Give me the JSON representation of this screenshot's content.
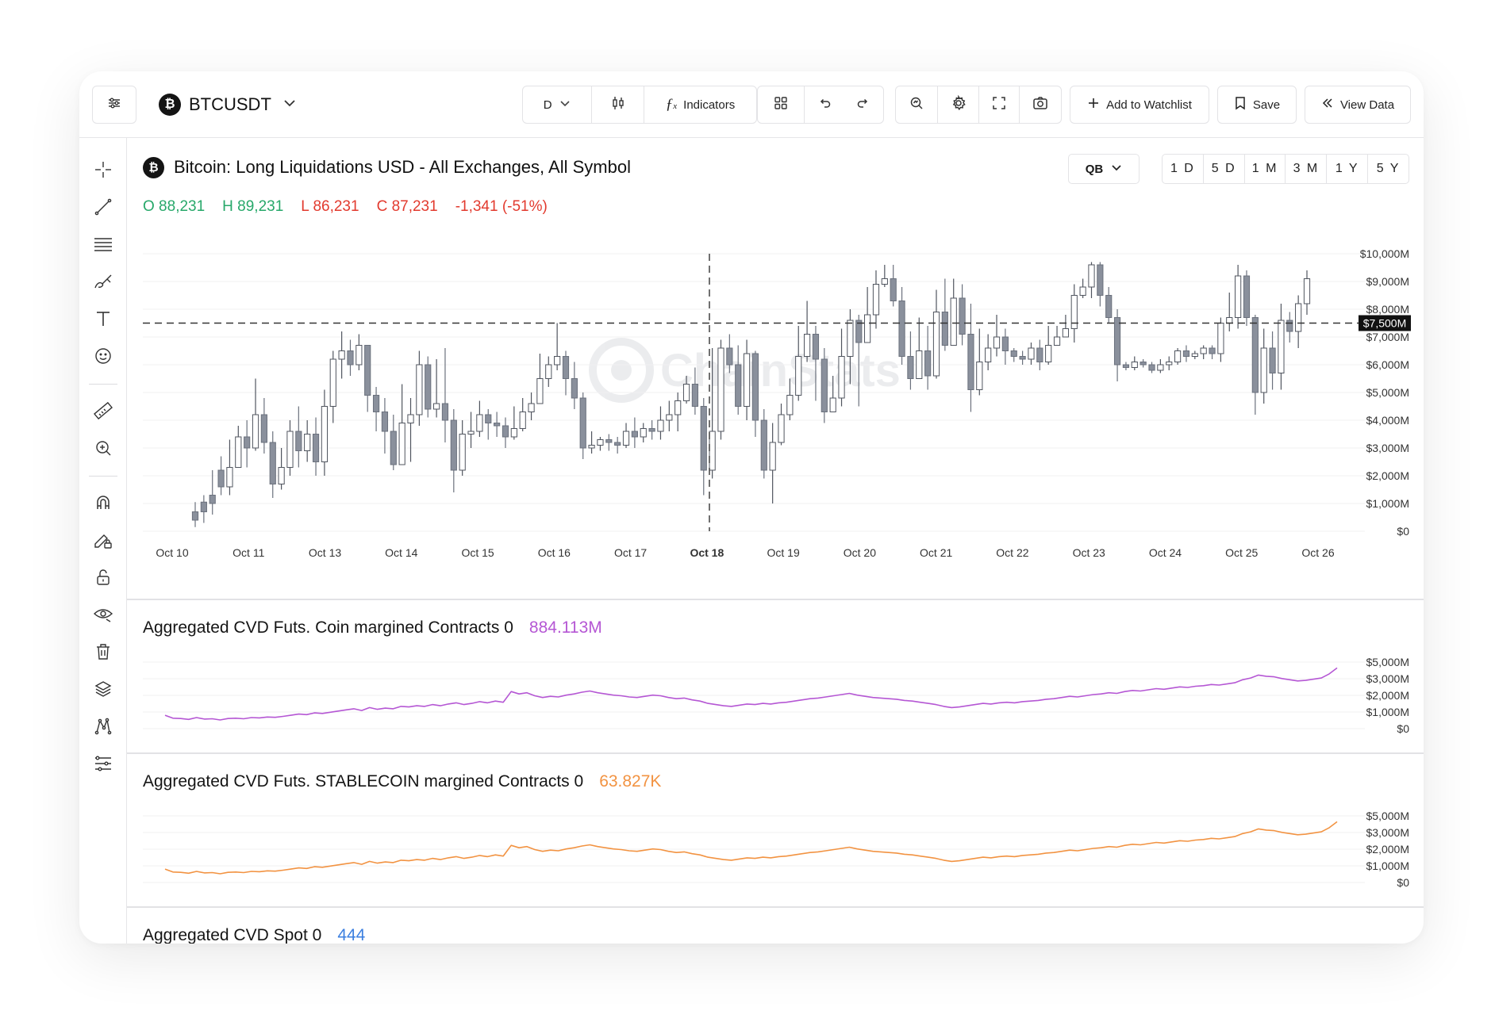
{
  "toolbar": {
    "symbol": "BTCUSDT",
    "interval": "D",
    "indicators_label": "Indicators",
    "add_watchlist_label": "Add to Watchlist",
    "save_label": "Save",
    "view_data_label": "View Data"
  },
  "chart": {
    "title": "Bitcoin: Long Liquidations USD - All Exchanges, All Symbol",
    "ohlc": {
      "open": "O 88,231",
      "high": "H 89,231",
      "low": "L 86,231",
      "close": "C 87,231",
      "change": "-1,341 (-51%)"
    },
    "source_selector": "QB",
    "ranges": [
      "1 D",
      "5 D",
      "1 M",
      "3 M",
      "1 Y",
      "5 Y"
    ],
    "watermark": "ChainStats",
    "price_label": "$7,500M",
    "crosshair_date": "Oct 18"
  },
  "colors": {
    "up": "#27a86a",
    "down": "#e23a2e",
    "coin_cvd": "#b557d4",
    "stable_cvd": "#f29342",
    "spot_cvd": "#3b7fe0",
    "candle_bear": "#8a909c"
  },
  "chart_data": [
    {
      "type": "candlestick",
      "title": "Bitcoin: Long Liquidations USD - All Exchanges, All Symbol",
      "x_tick_labels": [
        "Oct 10",
        "Oct 11",
        "Oct 13",
        "Oct 14",
        "Oct 15",
        "Oct 16",
        "Oct 17",
        "Oct 18",
        "Oct 19",
        "Oct 20",
        "Oct 21",
        "Oct 22",
        "Oct 23",
        "Oct 24",
        "Oct 25",
        "Oct 26"
      ],
      "y_tick_labels": [
        "$10,000M",
        "$9,000M",
        "$8,000M",
        "$7,000M",
        "$6,000M",
        "$5,000M",
        "$4,000M",
        "$3,000M",
        "$2,000M",
        "$1,000M",
        "$0"
      ],
      "ylim": [
        0,
        10000
      ],
      "y_unit": "$M",
      "horizontal_line": 7500,
      "candles": [
        [
          700,
          400,
          1050,
          150
        ],
        [
          1050,
          700,
          1300,
          300
        ],
        [
          1300,
          1000,
          2200,
          600
        ],
        [
          2200,
          1600,
          2700,
          1300
        ],
        [
          1600,
          2300,
          3300,
          1300
        ],
        [
          2300,
          3400,
          3800,
          2500
        ],
        [
          3400,
          3000,
          4000,
          2300
        ],
        [
          3000,
          4200,
          5500,
          2900
        ],
        [
          4200,
          3200,
          4800,
          2800
        ],
        [
          3200,
          1700,
          3600,
          1200
        ],
        [
          1700,
          2300,
          3000,
          1500
        ],
        [
          2300,
          3600,
          4000,
          2000
        ],
        [
          3600,
          2900,
          4500,
          2300
        ],
        [
          2900,
          3500,
          4000,
          2500
        ],
        [
          3500,
          2500,
          4100,
          2000
        ],
        [
          2500,
          4500,
          5100,
          2000
        ],
        [
          4500,
          6200,
          6500,
          3900
        ],
        [
          6200,
          6500,
          7200,
          5500
        ],
        [
          6500,
          6000,
          6900,
          5600
        ],
        [
          6000,
          6700,
          7100,
          5800
        ],
        [
          6700,
          4900,
          6200,
          4300
        ],
        [
          4900,
          4300,
          5200,
          3600
        ],
        [
          4300,
          3600,
          4800,
          2800
        ],
        [
          3600,
          2400,
          4200,
          2200
        ],
        [
          2400,
          3900,
          5300,
          3200
        ],
        [
          3900,
          4200,
          4800,
          2500
        ],
        [
          4200,
          6000,
          6500,
          3800
        ],
        [
          6000,
          4400,
          6300,
          4100
        ],
        [
          4400,
          4600,
          6200,
          4100
        ],
        [
          4600,
          4000,
          6600,
          3200
        ],
        [
          4000,
          2200,
          4400,
          1400
        ],
        [
          2200,
          3500,
          4000,
          2000
        ],
        [
          3500,
          3600,
          4300,
          3000
        ],
        [
          3600,
          4200,
          4700,
          3400
        ],
        [
          4200,
          3900,
          4400,
          3300
        ],
        [
          3900,
          3800,
          4300,
          3400
        ],
        [
          3800,
          3400,
          4100,
          3000
        ],
        [
          3400,
          3700,
          4500,
          3300
        ],
        [
          3700,
          4300,
          4800,
          3600
        ],
        [
          4300,
          4600,
          5000,
          4000
        ],
        [
          4600,
          5500,
          6400,
          5000
        ],
        [
          5500,
          6000,
          6300,
          5200
        ],
        [
          6000,
          6300,
          7500,
          5800
        ],
        [
          6300,
          5500,
          6500,
          4900
        ],
        [
          5500,
          4800,
          6100,
          4400
        ],
        [
          4800,
          3000,
          5000,
          2600
        ],
        [
          3000,
          3100,
          3600,
          2800
        ],
        [
          3100,
          3300,
          3400,
          2900
        ],
        [
          3300,
          3200,
          3500,
          2900
        ],
        [
          3200,
          3100,
          3400,
          2800
        ],
        [
          3100,
          3600,
          3900,
          3000
        ],
        [
          3600,
          3400,
          4100,
          3000
        ],
        [
          3400,
          3700,
          3900,
          3200
        ],
        [
          3700,
          3600,
          4000,
          3300
        ],
        [
          3600,
          4000,
          4500,
          3300
        ],
        [
          4000,
          4200,
          4700,
          3600
        ],
        [
          4200,
          4700,
          5000,
          3600
        ],
        [
          4700,
          5300,
          5600,
          4600
        ],
        [
          5300,
          4500,
          5900,
          4200
        ],
        [
          4500,
          2200,
          4800,
          1300
        ],
        [
          2200,
          3600,
          6600,
          1900
        ],
        [
          3600,
          6600,
          6900,
          3300
        ],
        [
          6600,
          6000,
          7100,
          5700
        ],
        [
          6000,
          4500,
          6700,
          4200
        ],
        [
          4500,
          6400,
          6900,
          4000
        ],
        [
          6400,
          4000,
          6500,
          3400
        ],
        [
          4000,
          2200,
          4400,
          1900
        ],
        [
          2200,
          3200,
          3900,
          1000
        ],
        [
          3200,
          4200,
          4600,
          3100
        ],
        [
          4200,
          4900,
          5500,
          4000
        ],
        [
          4900,
          6300,
          7400,
          4700
        ],
        [
          6300,
          7100,
          8300,
          6100
        ],
        [
          7100,
          6200,
          7400,
          4700
        ],
        [
          6200,
          4300,
          6600,
          3900
        ],
        [
          4300,
          4800,
          5600,
          4300
        ],
        [
          4800,
          6300,
          7300,
          4500
        ],
        [
          6300,
          7600,
          8000,
          5300
        ],
        [
          7600,
          6800,
          7800,
          4500
        ],
        [
          6800,
          7800,
          8800,
          6800
        ],
        [
          7800,
          8900,
          9400,
          7300
        ],
        [
          8900,
          9100,
          9600,
          8800
        ],
        [
          9100,
          8300,
          9600,
          8100
        ],
        [
          8300,
          6300,
          8800,
          6000
        ],
        [
          6300,
          5500,
          7200,
          5100
        ],
        [
          5500,
          6500,
          7700,
          6000
        ],
        [
          6500,
          5600,
          7400,
          5100
        ],
        [
          5600,
          7900,
          8700,
          5500
        ],
        [
          7900,
          6700,
          9100,
          6500
        ],
        [
          6700,
          8400,
          9100,
          7300
        ],
        [
          8400,
          7100,
          8900,
          6700
        ],
        [
          7100,
          5100,
          8200,
          4300
        ],
        [
          5100,
          6100,
          7300,
          4900
        ],
        [
          6100,
          6600,
          7100,
          5800
        ],
        [
          6600,
          7000,
          7800,
          6300
        ],
        [
          7000,
          6500,
          7300,
          6000
        ],
        [
          6500,
          6300,
          6600,
          6100
        ],
        [
          6300,
          6200,
          6500,
          6000
        ],
        [
          6200,
          6600,
          6800,
          6000
        ],
        [
          6600,
          6100,
          6900,
          5800
        ],
        [
          6100,
          6700,
          7400,
          6000
        ],
        [
          6700,
          7000,
          7400,
          6700
        ],
        [
          7000,
          7300,
          7800,
          7000
        ],
        [
          7300,
          8500,
          8900,
          6800
        ],
        [
          8500,
          8800,
          9100,
          8400
        ],
        [
          8800,
          9600,
          9700,
          8400
        ],
        [
          9600,
          8500,
          9700,
          8100
        ],
        [
          8500,
          7700,
          8800,
          7500
        ],
        [
          7700,
          6000,
          8000,
          5400
        ],
        [
          6000,
          5900,
          6100,
          5800
        ],
        [
          5900,
          6100,
          6300,
          5800
        ],
        [
          6100,
          6000,
          6200,
          5900
        ],
        [
          6000,
          5800,
          6100,
          5700
        ],
        [
          5800,
          6000,
          6200,
          5700
        ],
        [
          6000,
          6100,
          6300,
          5800
        ],
        [
          6100,
          6500,
          6600,
          6000
        ],
        [
          6500,
          6300,
          6700,
          6100
        ],
        [
          6300,
          6400,
          6500,
          6200
        ],
        [
          6400,
          6600,
          6700,
          6200
        ],
        [
          6600,
          6400,
          6700,
          6200
        ],
        [
          6400,
          7500,
          7700,
          6100
        ],
        [
          7500,
          7700,
          8600,
          7200
        ],
        [
          7700,
          9200,
          9600,
          7300
        ],
        [
          9200,
          7700,
          9400,
          7400
        ],
        [
          7700,
          5000,
          7800,
          4200
        ],
        [
          5000,
          6600,
          7300,
          4600
        ],
        [
          6600,
          5700,
          7200,
          5100
        ],
        [
          5700,
          7600,
          8200,
          5100
        ],
        [
          7600,
          7200,
          7900,
          6800
        ],
        [
          7200,
          8200,
          8500,
          6600
        ],
        [
          8200,
          9100,
          9400,
          7800
        ]
      ]
    },
    {
      "type": "line",
      "title": "Aggregated CVD Futs. Coin margined Contracts 0",
      "value_label": "884.113M",
      "y_tick_labels": [
        "$5,000M",
        "$3,000M",
        "$2,000M",
        "$1,000M",
        "$0"
      ],
      "values": [
        1200,
        700,
        650,
        500,
        800,
        550,
        600,
        400,
        650,
        700,
        600,
        800,
        750,
        900,
        850,
        1000,
        1200,
        1400,
        1300,
        1600,
        1500,
        1700,
        1900,
        2100,
        2300,
        2000,
        2500,
        2200,
        2400,
        2300,
        2700,
        2600,
        2800,
        2700,
        3000,
        2800,
        3100,
        3300,
        3000,
        3200,
        3500,
        3300,
        3600,
        3400,
        5200,
        4800,
        5000,
        4500,
        4200,
        4400,
        4300,
        4600,
        4800,
        5100,
        5300,
        5000,
        4800,
        4600,
        4500,
        4300,
        4200,
        4400,
        4600,
        4500,
        4200,
        4000,
        4100,
        3800,
        3600,
        3200,
        3000,
        2800,
        2700,
        2900,
        3100,
        3000,
        3200,
        3100,
        3300,
        3400,
        3600,
        3800,
        4000,
        4100,
        4300,
        4500,
        4700,
        4900,
        4600,
        4400,
        4200,
        4100,
        4000,
        3900,
        3700,
        3600,
        3400,
        3200,
        3000,
        2700,
        2500,
        2600,
        2800,
        3000,
        3200,
        3100,
        3300,
        3400,
        3300,
        3500,
        3600,
        3700,
        3900,
        4000,
        4200,
        4400,
        4300,
        4500,
        4700,
        4800,
        5000,
        4900,
        5200,
        5400,
        5300,
        5500,
        5700,
        5600,
        5800,
        6000,
        5900,
        6100,
        6200,
        6400,
        6300,
        6500,
        6700,
        7200,
        7500,
        8000,
        7800,
        7700,
        7400,
        7200,
        7000,
        7100,
        7300,
        7500,
        8200,
        9200
      ]
    },
    {
      "type": "line",
      "title": "Aggregated CVD Futs. STABLECOIN margined Contracts 0",
      "value_label": "63.827K",
      "y_tick_labels": [
        "$5,000M",
        "$3,000M",
        "$2,000M",
        "$1,000M",
        "$0"
      ],
      "values": [
        1200,
        700,
        650,
        500,
        800,
        550,
        600,
        400,
        650,
        700,
        600,
        800,
        750,
        900,
        850,
        1000,
        1200,
        1400,
        1300,
        1600,
        1500,
        1700,
        1900,
        2100,
        2300,
        2000,
        2500,
        2200,
        2400,
        2300,
        2700,
        2600,
        2800,
        2700,
        3000,
        2800,
        3100,
        3300,
        3000,
        3200,
        3500,
        3300,
        3600,
        3400,
        5200,
        4800,
        5000,
        4500,
        4200,
        4400,
        4300,
        4600,
        4800,
        5100,
        5300,
        5000,
        4800,
        4600,
        4500,
        4300,
        4200,
        4400,
        4600,
        4500,
        4200,
        4000,
        4100,
        3800,
        3600,
        3200,
        3000,
        2800,
        2700,
        2900,
        3100,
        3000,
        3200,
        3100,
        3300,
        3400,
        3600,
        3800,
        4000,
        4100,
        4300,
        4500,
        4700,
        4900,
        4600,
        4400,
        4200,
        4100,
        4000,
        3900,
        3700,
        3600,
        3400,
        3200,
        3000,
        2700,
        2500,
        2600,
        2800,
        3000,
        3200,
        3100,
        3300,
        3400,
        3300,
        3500,
        3600,
        3700,
        3900,
        4000,
        4200,
        4400,
        4300,
        4500,
        4700,
        4800,
        5000,
        4900,
        5200,
        5400,
        5300,
        5500,
        5700,
        5600,
        5800,
        6000,
        5900,
        6100,
        6200,
        6400,
        6300,
        6500,
        6700,
        7200,
        7500,
        8000,
        7800,
        7700,
        7400,
        7200,
        7000,
        7100,
        7300,
        7500,
        8200,
        9200
      ]
    }
  ],
  "panes": {
    "coin": {
      "title": "Aggregated CVD Futs. Coin margined Contracts 0",
      "value": "884.113M"
    },
    "stable": {
      "title": "Aggregated CVD Futs. STABLECOIN margined Contracts 0",
      "value": "63.827K"
    },
    "spot": {
      "title": "Aggregated CVD Spot 0",
      "value": "444"
    }
  },
  "icons": [
    "sliders-icon",
    "chevron-down-icon",
    "candles-icon",
    "function-icon",
    "layout-grid-icon",
    "undo-icon",
    "redo-icon",
    "search-chart-icon",
    "gear-icon",
    "fullscreen-icon",
    "camera-icon",
    "plus-icon",
    "bookmark-icon",
    "double-chevron-left-icon",
    "crosshair-icon",
    "trend-line-icon",
    "fib-lines-icon",
    "brush-icon",
    "text-icon",
    "emoji-icon",
    "ruler-icon",
    "zoom-in-icon",
    "magnet-icon",
    "pencil-lock-icon",
    "lock-icon",
    "eye-icon",
    "trash-icon",
    "layers-icon",
    "pattern-icon",
    "settings-list-icon"
  ]
}
